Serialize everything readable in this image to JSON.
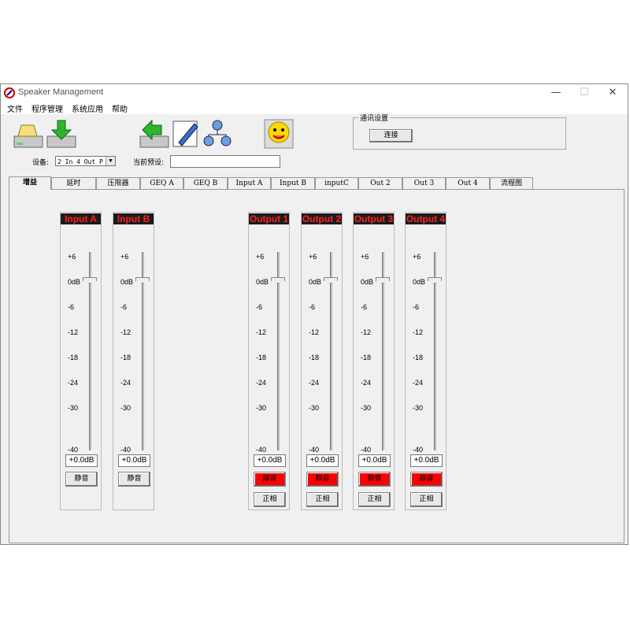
{
  "window": {
    "title": "Speaker Management",
    "controls": {
      "minimize": "—",
      "maximize": "☐",
      "close": "✕"
    }
  },
  "menu": [
    "文件",
    "程序管理",
    "系统应用",
    "帮助"
  ],
  "toolbar": {
    "icons": [
      "open-folder-icon",
      "download-icon",
      "upload-icon",
      "edit-icon",
      "network-icon",
      "smiley-icon"
    ]
  },
  "device": {
    "label": "设备:",
    "selected": "2 In 4 Out P"
  },
  "preset": {
    "label": "当前预设:",
    "value": ""
  },
  "comm": {
    "title": "通讯设置",
    "connect_label": "连接"
  },
  "tabs": [
    "增益",
    "延时",
    "压限器",
    "GEQ A",
    "GEQ B",
    "Input A",
    "Input B",
    "inputC",
    "Out 2",
    "Out 3",
    "Out 4",
    "流程图"
  ],
  "active_tab": 0,
  "fader_scale": [
    "+6",
    "0dB",
    "-6",
    "-12",
    "-18",
    "-24",
    "-30",
    "-40"
  ],
  "strips": [
    {
      "name": "Input A",
      "value": "+0.0dB",
      "mute": "静音",
      "muted": false
    },
    {
      "name": "Input B",
      "value": "+0.0dB",
      "mute": "静音",
      "muted": false
    },
    {
      "name": "Output 1",
      "value": "+0.0dB",
      "mute": "静音",
      "muted": true,
      "phase": "正相"
    },
    {
      "name": "Output 2",
      "value": "+0.0dB",
      "mute": "静音",
      "muted": true,
      "phase": "正相"
    },
    {
      "name": "Output 3",
      "value": "+0.0dB",
      "mute": "静音",
      "muted": true,
      "phase": "正相"
    },
    {
      "name": "Output 4",
      "value": "+0.0dB",
      "mute": "静音",
      "muted": true,
      "phase": "正相"
    }
  ],
  "colors": {
    "strip_title_bg": "#1a1a1a",
    "strip_title_text": "#ff2020",
    "mute_active": "#ff0000"
  }
}
